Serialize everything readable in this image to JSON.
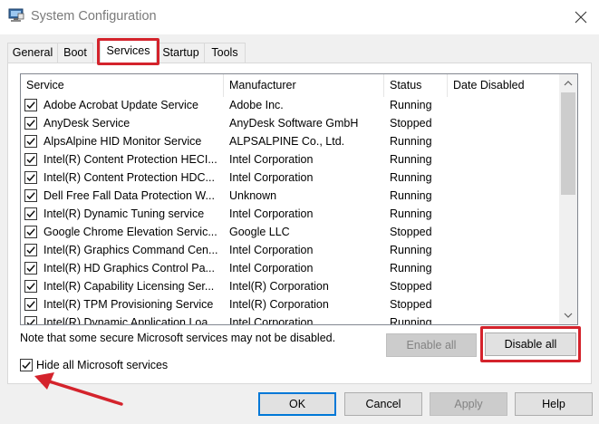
{
  "window": {
    "title": "System Configuration",
    "close_glyph": "✕"
  },
  "tabs": [
    {
      "label": "General",
      "active": false
    },
    {
      "label": "Boot",
      "active": false
    },
    {
      "label": "Services",
      "active": true
    },
    {
      "label": "Startup",
      "active": false
    },
    {
      "label": "Tools",
      "active": false
    }
  ],
  "list": {
    "columns": [
      "Service",
      "Manufacturer",
      "Status",
      "Date Disabled"
    ],
    "rows": [
      {
        "service": "Adobe Acrobat Update Service",
        "manufacturer": "Adobe Inc.",
        "status": "Running",
        "date": "",
        "checked": true
      },
      {
        "service": "AnyDesk Service",
        "manufacturer": "AnyDesk Software GmbH",
        "status": "Stopped",
        "date": "",
        "checked": true
      },
      {
        "service": "AlpsAlpine HID Monitor Service",
        "manufacturer": "ALPSALPINE  Co., Ltd.",
        "status": "Running",
        "date": "",
        "checked": true
      },
      {
        "service": "Intel(R) Content Protection HECI...",
        "manufacturer": "Intel Corporation",
        "status": "Running",
        "date": "",
        "checked": true
      },
      {
        "service": "Intel(R) Content Protection HDC...",
        "manufacturer": "Intel Corporation",
        "status": "Running",
        "date": "",
        "checked": true
      },
      {
        "service": "Dell Free Fall Data Protection W...",
        "manufacturer": "Unknown",
        "status": "Running",
        "date": "",
        "checked": true
      },
      {
        "service": "Intel(R) Dynamic Tuning service",
        "manufacturer": "Intel Corporation",
        "status": "Running",
        "date": "",
        "checked": true
      },
      {
        "service": "Google Chrome Elevation Servic...",
        "manufacturer": "Google LLC",
        "status": "Stopped",
        "date": "",
        "checked": true
      },
      {
        "service": "Intel(R) Graphics Command Cen...",
        "manufacturer": "Intel Corporation",
        "status": "Running",
        "date": "",
        "checked": true
      },
      {
        "service": "Intel(R) HD Graphics Control Pa...",
        "manufacturer": "Intel Corporation",
        "status": "Running",
        "date": "",
        "checked": true
      },
      {
        "service": "Intel(R) Capability Licensing Ser...",
        "manufacturer": "Intel(R) Corporation",
        "status": "Stopped",
        "date": "",
        "checked": true
      },
      {
        "service": "Intel(R) TPM Provisioning Service",
        "manufacturer": "Intel(R) Corporation",
        "status": "Stopped",
        "date": "",
        "checked": true
      },
      {
        "service": "Intel(R) Dynamic Application Loa...",
        "manufacturer": "Intel Corporation",
        "status": "Running",
        "date": "",
        "checked": true
      }
    ]
  },
  "note": "Note that some secure Microsoft services may not be disabled.",
  "buttons": {
    "enable_all": "Enable all",
    "disable_all": "Disable all",
    "ok": "OK",
    "cancel": "Cancel",
    "apply": "Apply",
    "help": "Help"
  },
  "hide_ms": {
    "label": "Hide all Microsoft services",
    "checked": true
  },
  "colors": {
    "highlight_red": "#d4232c",
    "focus_blue": "#0078d7"
  }
}
